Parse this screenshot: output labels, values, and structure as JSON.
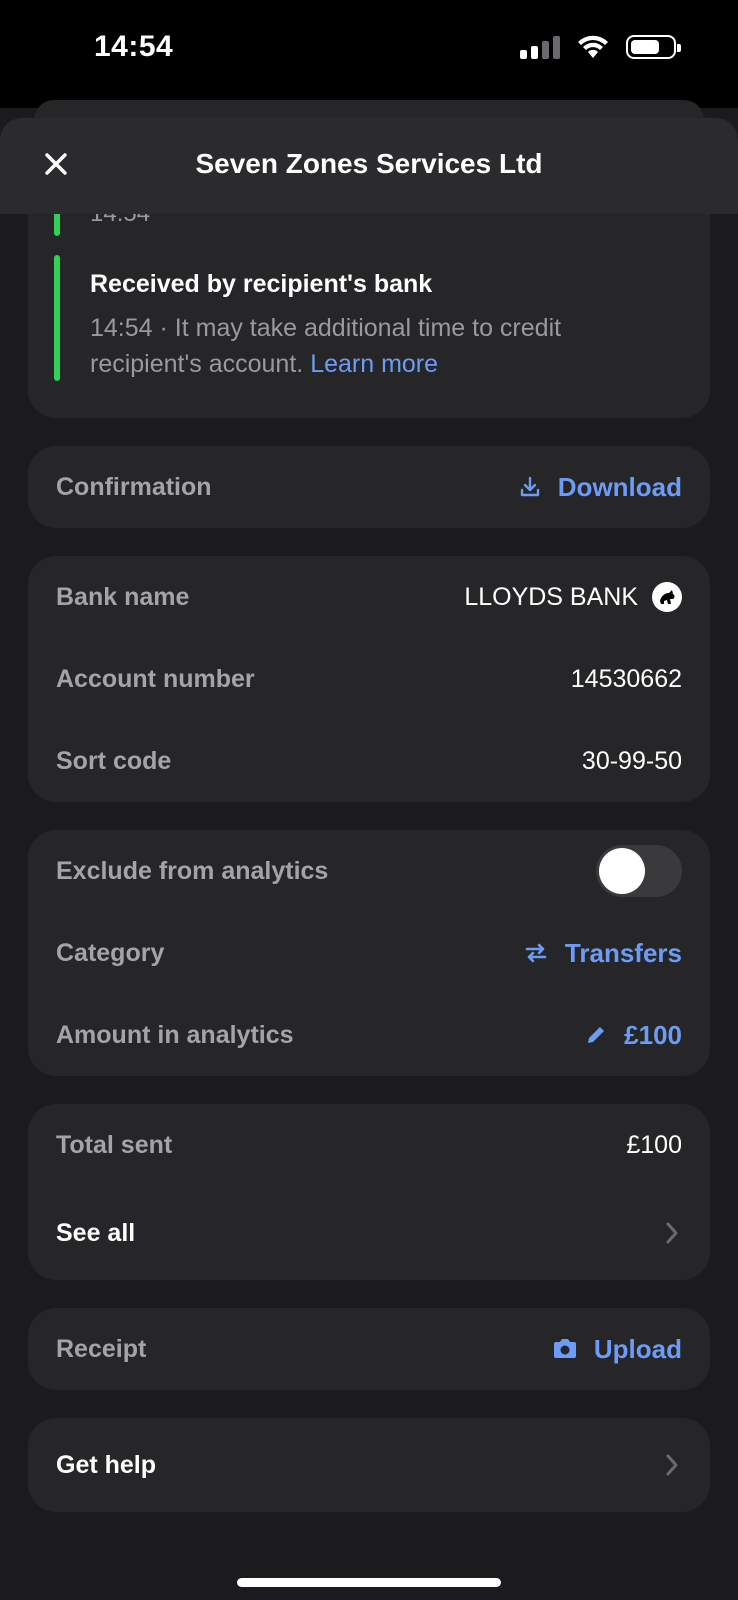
{
  "status_bar": {
    "time": "14:54"
  },
  "header": {
    "title": "Seven Zones Services Ltd"
  },
  "timeline": {
    "previous_time": "14:54",
    "step_title": "Received by recipient's bank",
    "step_desc": "14:54 · It may take additional time to credit recipient's account.",
    "step_link": "Learn more"
  },
  "confirmation": {
    "label": "Confirmation",
    "action": "Download"
  },
  "bank_details": {
    "bank_name_label": "Bank name",
    "bank_name": "LLOYDS BANK",
    "account_number_label": "Account number",
    "account_number": "14530662",
    "sort_code_label": "Sort code",
    "sort_code": "30-99-50"
  },
  "analytics": {
    "exclude_label": "Exclude from analytics",
    "exclude_on": false,
    "category_label": "Category",
    "category_value": "Transfers",
    "amount_label": "Amount in analytics",
    "amount_value": "£100"
  },
  "totals": {
    "total_sent_label": "Total sent",
    "total_sent_value": "£100",
    "see_all_label": "See all"
  },
  "receipt": {
    "label": "Receipt",
    "action": "Upload"
  },
  "help": {
    "label": "Get help"
  },
  "colors": {
    "accent": "#6c9cf5",
    "success": "#2fd158",
    "card": "#262628",
    "background": "#1b1b1d"
  }
}
